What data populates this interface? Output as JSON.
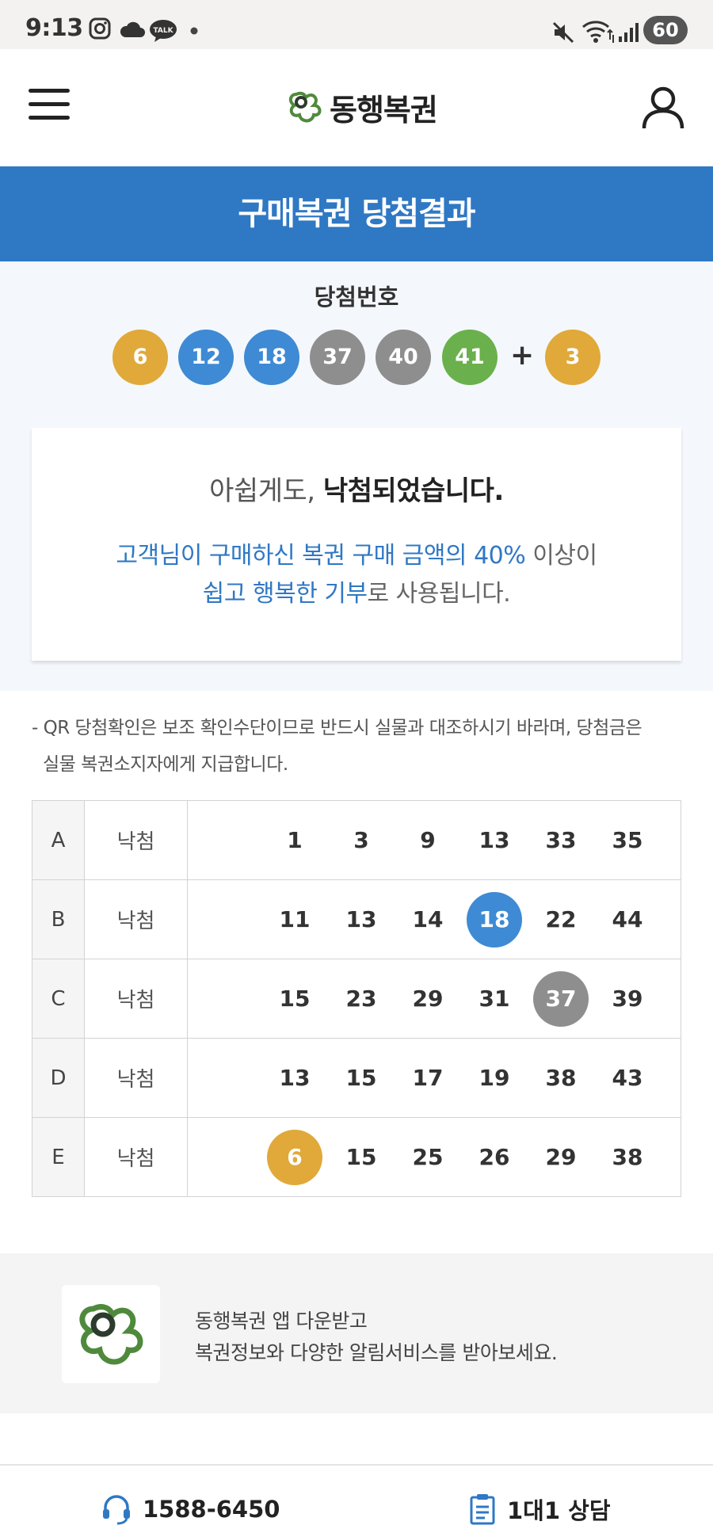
{
  "status_bar": {
    "time": "9:13",
    "battery": "60",
    "icons": [
      "instagram-icon",
      "cloud-icon",
      "kakaotalk-icon",
      "dot-icon",
      "mute-icon",
      "wifi-icon",
      "signal-icon",
      "battery-icon"
    ],
    "talk_label": "TALK"
  },
  "header": {
    "logo_text": "동행복권",
    "menu_icon": "hamburger-menu-icon",
    "user_icon": "user-icon"
  },
  "page": {
    "title": "구매복권 당첨결과"
  },
  "winning": {
    "label": "당첨번호",
    "numbers": [
      {
        "value": "6",
        "color": "#e0a93a"
      },
      {
        "value": "12",
        "color": "#3e8ad4"
      },
      {
        "value": "18",
        "color": "#3e8ad4"
      },
      {
        "value": "37",
        "color": "#8e8e8e"
      },
      {
        "value": "40",
        "color": "#8e8e8e"
      },
      {
        "value": "41",
        "color": "#6ab04c"
      }
    ],
    "plus": "+",
    "bonus": {
      "value": "3",
      "color": "#e0a93a"
    }
  },
  "result": {
    "prefix": "아쉽게도,",
    "emphasis": "낙첨되었습니다.",
    "line2_blue": "고객님이 구매하신 복권 구매 금액의 40%",
    "line2_tail": " 이상이",
    "line3_blue": "쉽고 행복한 기부",
    "line3_tail": "로 사용됩니다."
  },
  "notice": {
    "line1": "- QR 당첨확인은 보조 확인수단이므로 반드시 실물과 대조하시기 바라며, 당첨금은",
    "line2": "실물 복권소지자에게 지급합니다."
  },
  "games": [
    {
      "id": "A",
      "result": "낙첨",
      "numbers": [
        {
          "v": "1"
        },
        {
          "v": "3"
        },
        {
          "v": "9"
        },
        {
          "v": "13"
        },
        {
          "v": "33"
        },
        {
          "v": "35"
        }
      ]
    },
    {
      "id": "B",
      "result": "낙첨",
      "numbers": [
        {
          "v": "11"
        },
        {
          "v": "13"
        },
        {
          "v": "14"
        },
        {
          "v": "18",
          "hit": "#3e8ad4"
        },
        {
          "v": "22"
        },
        {
          "v": "44"
        }
      ]
    },
    {
      "id": "C",
      "result": "낙첨",
      "numbers": [
        {
          "v": "15"
        },
        {
          "v": "23"
        },
        {
          "v": "29"
        },
        {
          "v": "31"
        },
        {
          "v": "37",
          "hit": "#8e8e8e"
        },
        {
          "v": "39"
        }
      ]
    },
    {
      "id": "D",
      "result": "낙첨",
      "numbers": [
        {
          "v": "13"
        },
        {
          "v": "15"
        },
        {
          "v": "17"
        },
        {
          "v": "19"
        },
        {
          "v": "38"
        },
        {
          "v": "43"
        }
      ]
    },
    {
      "id": "E",
      "result": "낙첨",
      "numbers": [
        {
          "v": "6",
          "hit": "#e0a93a"
        },
        {
          "v": "15"
        },
        {
          "v": "25"
        },
        {
          "v": "26"
        },
        {
          "v": "29"
        },
        {
          "v": "38"
        }
      ]
    }
  ],
  "promo": {
    "line1": "동행복권 앱 다운받고",
    "line2": "복권정보와 다양한 알림서비스를 받아보세요."
  },
  "footer": {
    "phone": "1588-6450",
    "consult": "1대1 상담"
  },
  "colors": {
    "brand_blue": "#2f78c4",
    "logo_green": "#4f8a3c",
    "logo_dark": "#2d3b2e"
  }
}
